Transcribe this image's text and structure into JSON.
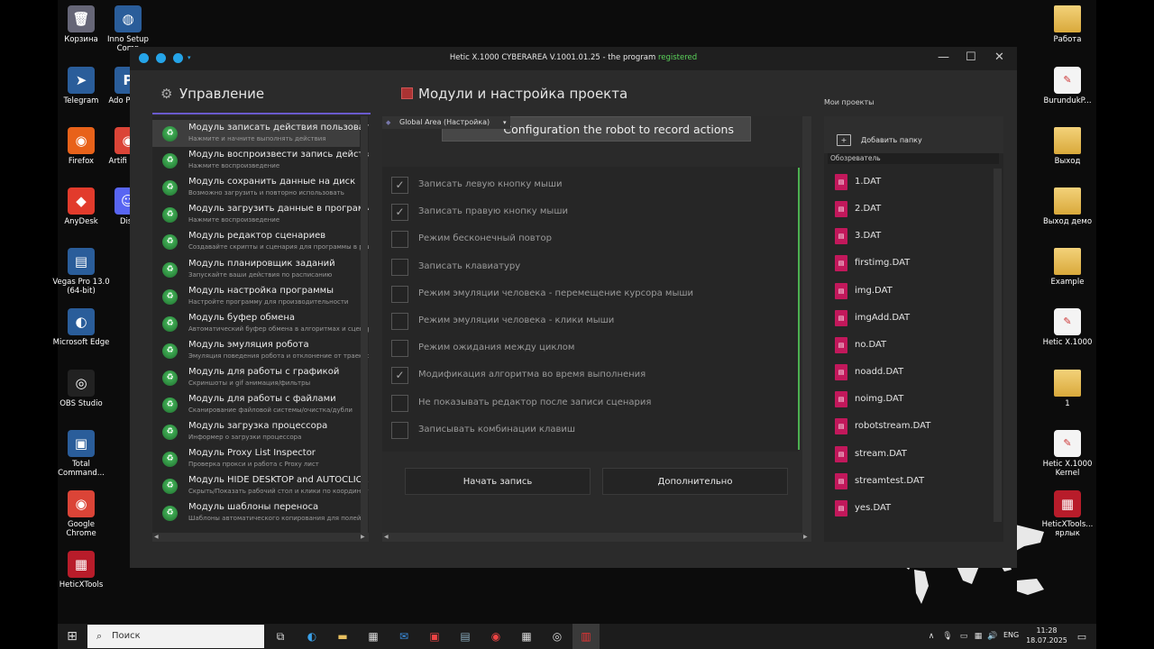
{
  "desktop_left": [
    {
      "label": "Корзина",
      "icon": "recycle-bin-icon",
      "glyph": "🗑"
    },
    {
      "label": "Telegram",
      "icon": "telegram-icon",
      "glyph": "➤"
    },
    {
      "label": "Firefox",
      "icon": "firefox-icon",
      "glyph": "◉"
    },
    {
      "label": "AnyDesk",
      "icon": "anydesk-icon",
      "glyph": "◆"
    },
    {
      "label": "Vegas Pro 13.0 (64-bit)",
      "icon": "vegas-icon",
      "glyph": "▤"
    },
    {
      "label": "Microsoft Edge",
      "icon": "edge-icon",
      "glyph": "◐"
    },
    {
      "label": "OBS Studio",
      "icon": "obs-icon",
      "glyph": "◎"
    },
    {
      "label": "Total Command...",
      "icon": "floppy-icon",
      "glyph": "▣"
    },
    {
      "label": "Google Chrome",
      "icon": "chrome-icon",
      "glyph": "◉"
    },
    {
      "label": "HeticXTools",
      "icon": "hetic-icon",
      "glyph": "▦"
    }
  ],
  "desktop_left2": [
    {
      "label": "Inno Setup Comp",
      "icon": "inno-icon",
      "glyph": "◍"
    },
    {
      "label": "Ado Photo",
      "icon": "photoshop-icon",
      "glyph": "P"
    },
    {
      "label": "Artifi Chro",
      "icon": "chrome2-icon",
      "glyph": "◉"
    },
    {
      "label": "Disc",
      "icon": "discord-icon",
      "glyph": "☺"
    }
  ],
  "desktop_right": [
    {
      "label": "Работа",
      "icon": "folder-icon",
      "glyph": ""
    },
    {
      "label": "BurundukP...",
      "icon": "document-icon",
      "glyph": "✎"
    },
    {
      "label": "Выход",
      "icon": "folder-icon",
      "glyph": ""
    },
    {
      "label": "Выход демо",
      "icon": "folder-icon",
      "glyph": ""
    },
    {
      "label": "Example",
      "icon": "folder-icon",
      "glyph": ""
    },
    {
      "label": "Hetic X.1000",
      "icon": "document-icon",
      "glyph": "✎"
    },
    {
      "label": "1",
      "icon": "folder-icon",
      "glyph": ""
    },
    {
      "label": "Hetic X.1000 Kernel",
      "icon": "document-icon",
      "glyph": "✎"
    },
    {
      "label": "HeticXTools... ярлык",
      "icon": "hetic-icon",
      "glyph": "▦"
    }
  ],
  "window": {
    "title_prefix": "Hetic X.1000 CYBERAREA V.1001.01.25 - the program ",
    "title_registered": "registered",
    "minimize": "—",
    "maximize": "☐",
    "close": "✕",
    "colors": {
      "accent": "#25a4e8",
      "registered": "#5bd35b",
      "progress": "#4caf50"
    }
  },
  "left_header": "Управление",
  "middle_header": "Модули и настройка проекта",
  "right_header": "Мои проекты",
  "modules": [
    {
      "title": "Модуль записать действия пользователя",
      "sub": "Нажмите и начните выполнять действия"
    },
    {
      "title": "Модуль воспроизвести запись действий",
      "sub": "Нажмите воспроизведение"
    },
    {
      "title": "Модуль сохранить данные на диск",
      "sub": "Возможно загрузить и повторно использовать"
    },
    {
      "title": "Модуль загрузить данные в программу",
      "sub": "Нажмите воспроизведение"
    },
    {
      "title": "Модуль редактор сценариев",
      "sub": "Создавайте скрипты и сценария для программы в редакторе"
    },
    {
      "title": "Модуль планировщик заданий",
      "sub": "Запускайте ваши действия по расписанию"
    },
    {
      "title": "Модуль настройка программы",
      "sub": "Настройте программу для производительности"
    },
    {
      "title": "Модуль буфер обмена",
      "sub": "Автоматический буфер обмена в алгоритмах и сценариях"
    },
    {
      "title": "Модуль эмуляция робота",
      "sub": "Эмуляция поведения робота и отклонение от траектории"
    },
    {
      "title": "Модуль для работы с графикой",
      "sub": "Скриншоты и gif анимация/фильтры"
    },
    {
      "title": "Модуль для работы с файлами",
      "sub": "Сканирование файловой системы/очистка/дубли"
    },
    {
      "title": "Модуль загрузка процессора",
      "sub": "Информер о загрузки процессора"
    },
    {
      "title": "Модуль Proxy List Inspector",
      "sub": "Проверка прокси и работа с Proxy лист"
    },
    {
      "title": "Модуль HIDE DESKTOP and AUTOCLICKER",
      "sub": "Скрыть/Показать рабочий стол и клики по координатам"
    },
    {
      "title": "Модуль шаблоны переноса",
      "sub": "Шаблоны автоматического копирования для полей в"
    }
  ],
  "area_combo": "Global Area (Настройка)",
  "banner": "Configuration the robot to record actions",
  "options": [
    {
      "label": "Записать левую кнопку мыши",
      "checked": "✓"
    },
    {
      "label": "Записать правую кнопку мыши",
      "checked": "✓"
    },
    {
      "label": "Режим бесконечный повтор",
      "checked": ""
    },
    {
      "label": "Записать клавиатуру",
      "checked": ""
    },
    {
      "label": "Режим эмуляции человека - перемещение курсора мыши",
      "checked": ""
    },
    {
      "label": "Режим эмуляции человека - клики мыши",
      "checked": ""
    },
    {
      "label": "Режим ожидания между циклом",
      "checked": ""
    },
    {
      "label": "Модификация алгоритма во время выполнения",
      "checked": "✓"
    },
    {
      "label": "Не показывать редактор после записи сценария",
      "checked": ""
    },
    {
      "label": "Записывать комбинации клавиш",
      "checked": ""
    }
  ],
  "buttons": {
    "start": "Начать запись",
    "more": "Дополнительно"
  },
  "add_folder": "Добавить папку",
  "explorer": "Обозреватель",
  "files": [
    "1.DAT",
    "2.DAT",
    "3.DAT",
    "firstimg.DAT",
    "img.DAT",
    "imgAdd.DAT",
    "no.DAT",
    "noadd.DAT",
    "noimg.DAT",
    "robotstream.DAT",
    "stream.DAT",
    "streamtest.DAT",
    "yes.DAT"
  ],
  "taskbar": {
    "search": "Поиск",
    "lang": "ENG",
    "time": "11:28",
    "date": "18.07.2025"
  }
}
